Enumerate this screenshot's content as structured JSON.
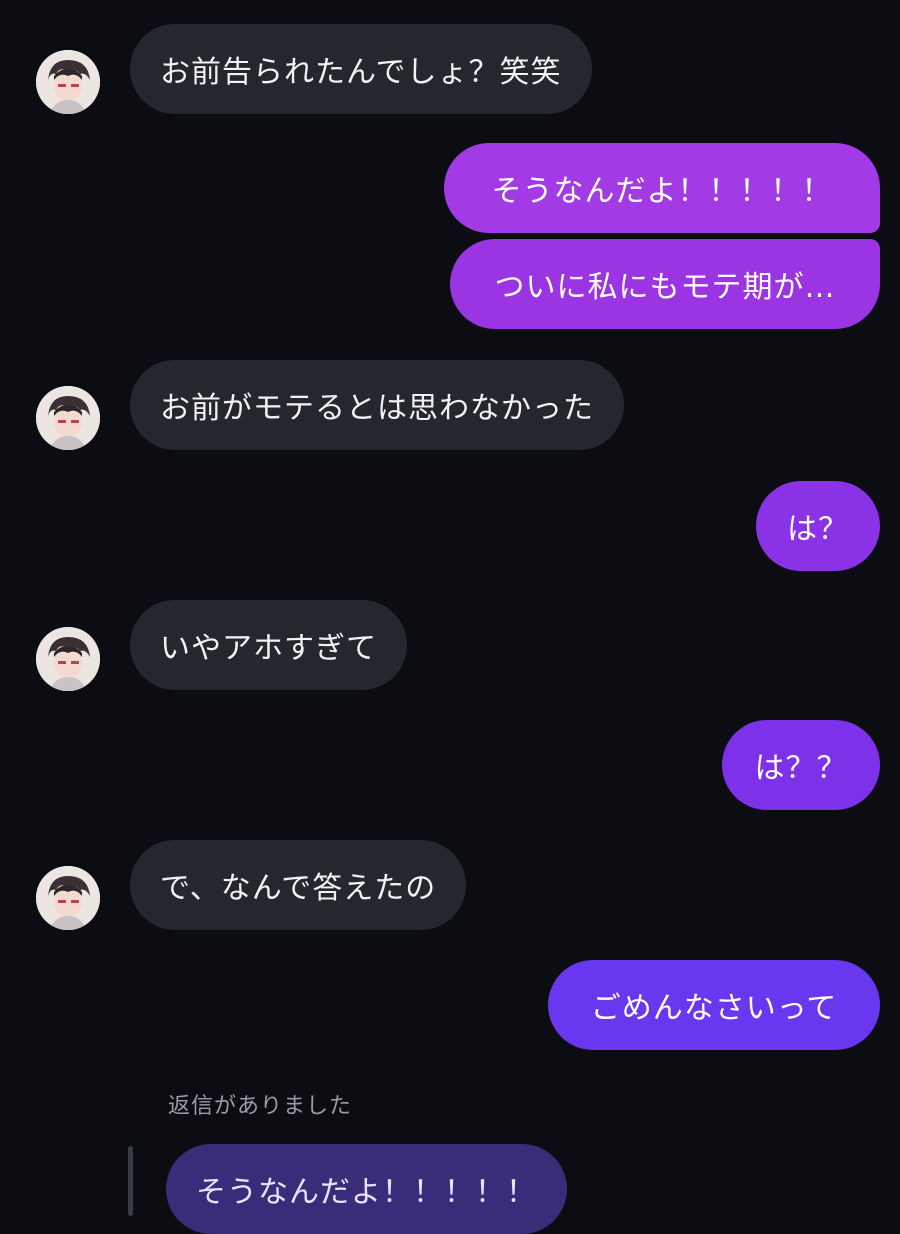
{
  "conversation": {
    "messages": [
      {
        "side": "in",
        "text": "お前告られたんでしょ？笑笑"
      },
      {
        "side": "out",
        "text": "そうなんだよ！！！！！",
        "color": "#a23be6"
      },
      {
        "side": "out",
        "text": "ついに私にもモテ期が…",
        "color": "#9b35e4"
      },
      {
        "side": "in",
        "text": "お前がモテるとは思わなかった"
      },
      {
        "side": "out",
        "text": "は？",
        "color": "#8a33e6"
      },
      {
        "side": "in",
        "text": "いやアホすぎて"
      },
      {
        "side": "out",
        "text": "は？？",
        "color": "#7d32ea"
      },
      {
        "side": "in",
        "text": "で、なんで答えたの"
      },
      {
        "side": "out",
        "text": "ごめんなさいって",
        "color": "#6a37f0"
      }
    ],
    "reply": {
      "label": "返信がありました",
      "quoted_text": "そうなんだよ！！！！！"
    }
  },
  "colors": {
    "background": "#0b0d13",
    "incoming_bubble": "#25272e",
    "reply_quote_bubble": "#3b2c7a"
  },
  "icons": {
    "avatar": "contact-avatar-anime-boy"
  }
}
